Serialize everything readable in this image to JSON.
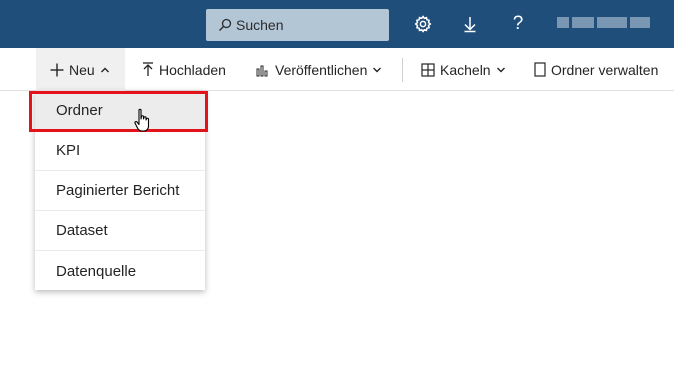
{
  "header": {
    "search": {
      "label": "Suchen",
      "icon": "search-icon"
    },
    "icons": [
      "gear-icon",
      "download-icon",
      "help-icon"
    ],
    "help_glyph": "?",
    "user": {
      "name_redacted": true
    }
  },
  "toolbar": {
    "new_label": "Neu",
    "upload_label": "Hochladen",
    "publish_label": "Veröffentlichen",
    "view_label": "Kacheln",
    "manage_label": "Ordner verwalten"
  },
  "menu": {
    "items": [
      {
        "label": "Ordner"
      },
      {
        "label": "KPI"
      },
      {
        "label": "Paginierter Bericht"
      },
      {
        "label": "Dataset"
      },
      {
        "label": "Datenquelle"
      }
    ]
  },
  "colors": {
    "header_bg": "#1f4e7a",
    "search_bg": "#b3c6d6",
    "highlight": "#e3121b",
    "hover": "#ececec"
  }
}
